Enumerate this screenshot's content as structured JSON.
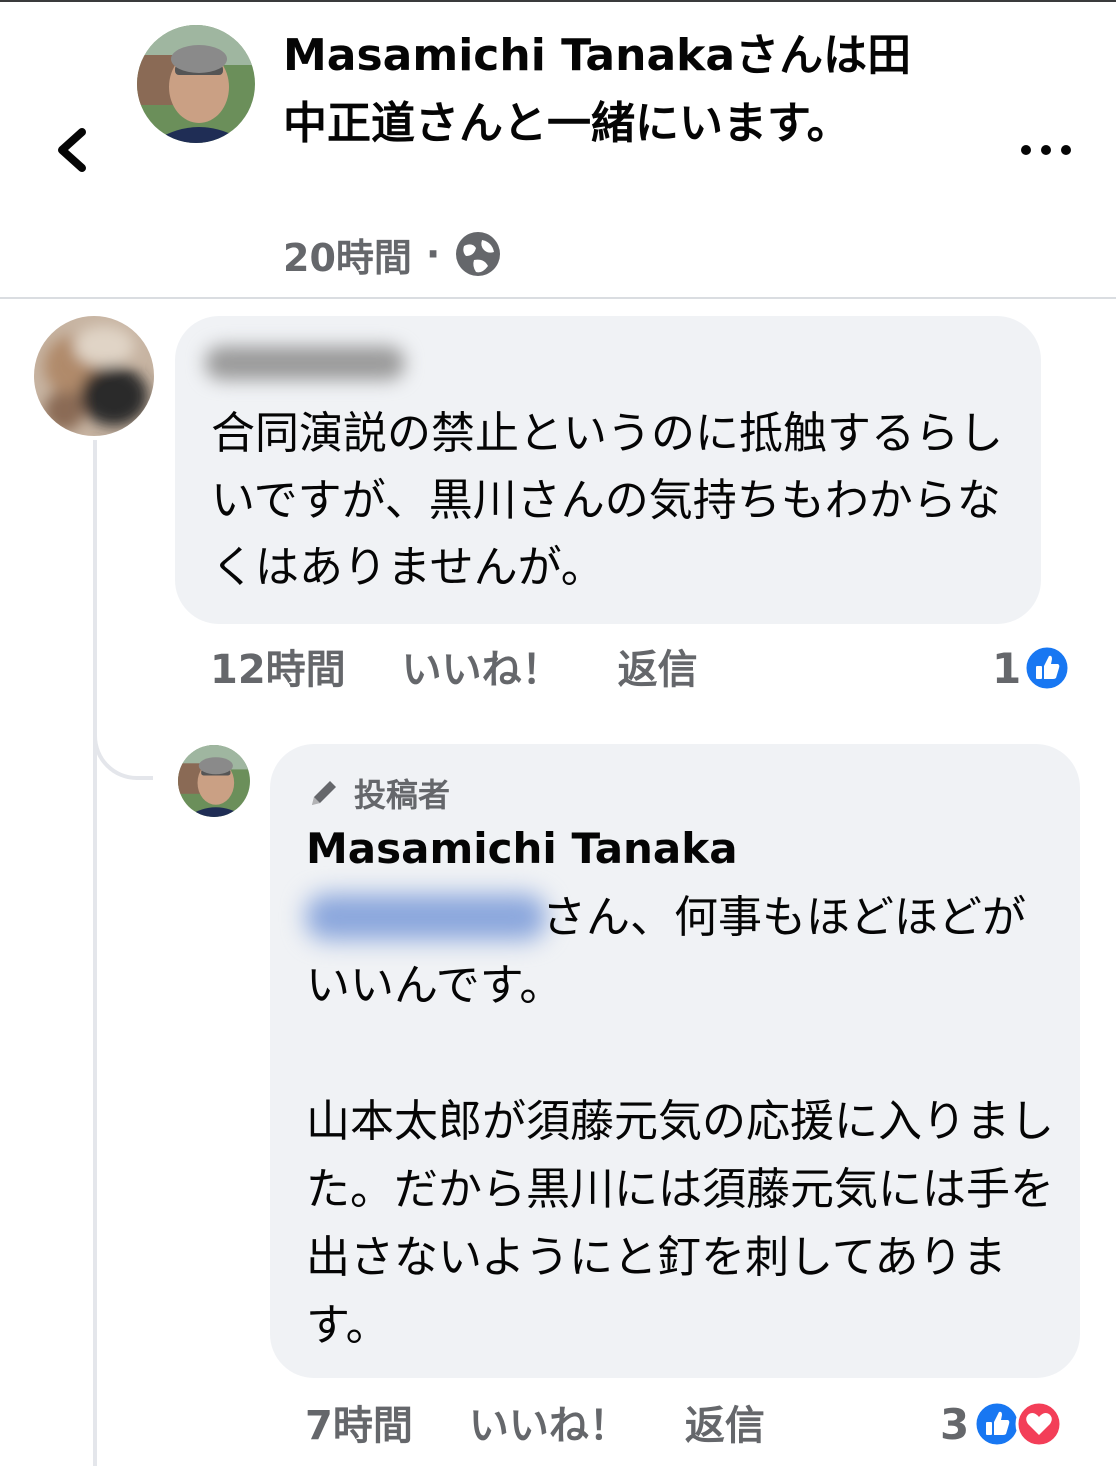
{
  "post": {
    "author": "Masamichi Tanaka",
    "title_rest": "さんは田中正道さんと一緒にいます。",
    "time": "20時間",
    "separator": "·",
    "privacy_icon": "globe-icon"
  },
  "comment1": {
    "text": "合同演説の禁止というのに抵触するらしいですが、黒川さんの気持ちもわからなくはありませんが。",
    "time": "12時間",
    "like": "いいね！",
    "reply": "返信",
    "reaction_count": "1",
    "reactions": [
      "like"
    ]
  },
  "comment2": {
    "badge": "投稿者",
    "author": "Masamichi Tanaka",
    "line1": "さん、何事もほどほどがいいんです。",
    "paragraph2": "山本太郎が須藤元気の応援に入りました。だから黒川には須藤元気には手を出さないようにと釘を刺してあります。",
    "time": "7時間",
    "like": "いいね！",
    "reply": "返信",
    "reaction_count": "3",
    "reactions": [
      "like",
      "love"
    ]
  },
  "colors": {
    "like_blue": "#1877f2",
    "love_red": "#f33e58",
    "meta_gray": "#65676b",
    "bubble_bg": "#f0f2f5"
  }
}
